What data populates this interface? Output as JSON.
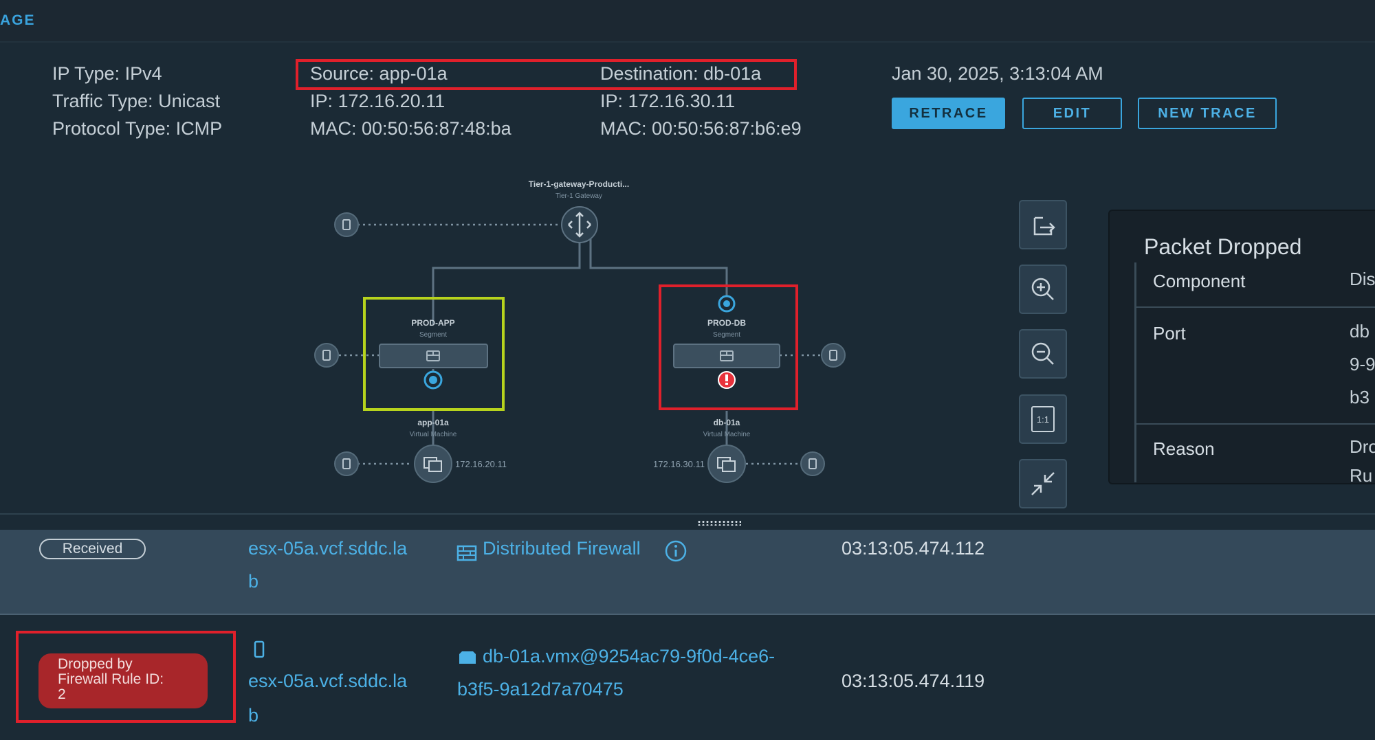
{
  "page_tab": "AGE",
  "trace_info": {
    "ip_type": {
      "key": "IP Type:",
      "value": "IPv4"
    },
    "traffic_type": {
      "key": "Traffic Type:",
      "value": "Unicast"
    },
    "protocol_type": {
      "key": "Protocol Type:",
      "value": "ICMP"
    },
    "source": "Source: app-01a",
    "source_ip": "IP: 172.16.20.11",
    "source_mac": "MAC: 00:50:56:87:48:ba",
    "destination": "Destination: db-01a",
    "destination_ip": "IP: 172.16.30.11",
    "destination_mac": "MAC: 00:50:56:87:b6:e9",
    "timestamp": "Jan 30, 2025, 3:13:04 AM"
  },
  "buttons": {
    "retrace": "RETRACE",
    "edit": "EDIT",
    "new_trace": "NEW TRACE"
  },
  "topology": {
    "gateway": {
      "name": "Tier-1-gateway-Producti...",
      "type": "Tier-1 Gateway",
      "icon": "router-icon"
    },
    "segments": [
      {
        "name": "PROD-APP",
        "type": "Segment",
        "status": "ok"
      },
      {
        "name": "PROD-DB",
        "type": "Segment",
        "status": "error"
      }
    ],
    "vms": [
      {
        "name": "app-01a",
        "type": "Virtual Machine",
        "ip": "172.16.20.11"
      },
      {
        "name": "db-01a",
        "type": "Virtual Machine",
        "ip": "172.16.30.11"
      }
    ]
  },
  "toolbar": [
    {
      "name": "export-icon",
      "label": ""
    },
    {
      "name": "zoom-in-icon",
      "label": ""
    },
    {
      "name": "zoom-out-icon",
      "label": ""
    },
    {
      "name": "actual-size-icon",
      "label": "1:1"
    },
    {
      "name": "collapse-icon",
      "label": ""
    }
  ],
  "details_panel": {
    "title": "Packet Dropped",
    "rows": [
      {
        "key": "Component",
        "value": "Dis"
      },
      {
        "key": "Port",
        "value_lines": [
          "db",
          "9-9",
          "b3"
        ]
      },
      {
        "key": "Reason",
        "value_lines": [
          "Dro",
          "Ru"
        ]
      }
    ]
  },
  "observations": [
    {
      "status": "Received",
      "host_lines": [
        "esx-05a.vcf.sddc.la",
        "b"
      ],
      "component": "Distributed Firewall",
      "component_icon": "firewall-icon",
      "time": "03:13:05.474.112"
    },
    {
      "status_lines": [
        "Dropped by",
        "Firewall Rule ID:",
        "2"
      ],
      "host_lines": [
        "esx-05a.vcf.sddc.la",
        "b"
      ],
      "host_icon": "host-icon",
      "component_lines": [
        "db-01a.vmx@9254ac79-9f0d-4ce6-",
        "b3f5-9a12d7a70475"
      ],
      "component_icon": "vnic-icon",
      "time": "03:13:05.474.119"
    }
  ],
  "colors": {
    "accent": "#3aa6de",
    "highlight_red": "#e0202b",
    "highlight_green": "#b7d31d",
    "drop": "#a8262a"
  }
}
